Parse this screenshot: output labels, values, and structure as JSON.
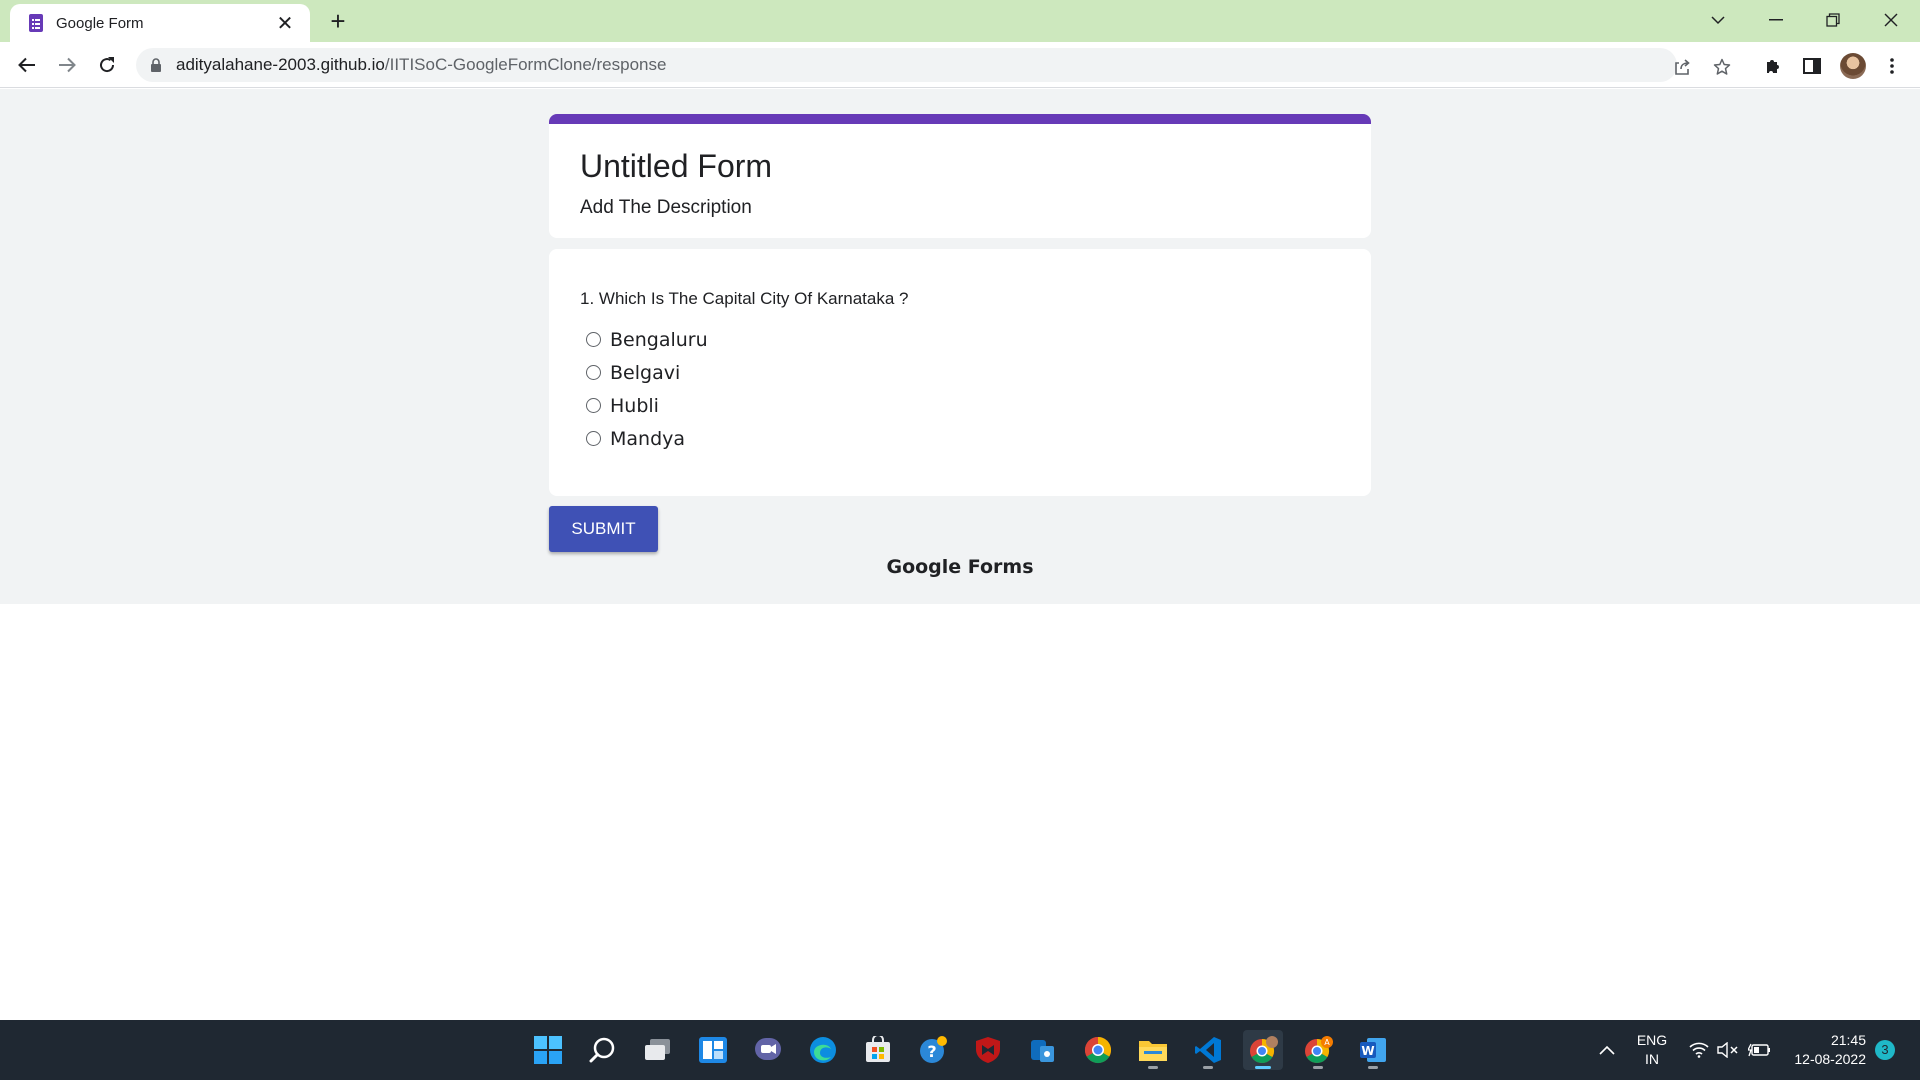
{
  "browser": {
    "tab_title": "Google Form",
    "url_host": "adityalahane-2003.github.io",
    "url_path": "/IITISoC-GoogleFormClone/response"
  },
  "form": {
    "accent_color": "#673ab7",
    "title": "Untitled Form",
    "description": "Add The Description",
    "question": {
      "text": "1. Which Is The Capital City Of Karnataka ?",
      "options": [
        "Bengaluru",
        "Belgavi",
        "Hubli",
        "Mandya"
      ]
    },
    "submit_label": "SUBMIT",
    "submit_color": "#3f51b5",
    "footer": "Google Forms"
  },
  "taskbar": {
    "apps": [
      "windows-start",
      "search",
      "task-view",
      "widgets",
      "teams-chat",
      "edge",
      "microsoft-store",
      "get-help",
      "mcafee",
      "phone-link",
      "chrome",
      "file-explorer",
      "vs-code",
      "chrome-profile-1",
      "chrome-profile-2",
      "word"
    ],
    "language": "ENG",
    "region": "IN",
    "time": "21:45",
    "date": "12-08-2022",
    "notifications": "3"
  }
}
